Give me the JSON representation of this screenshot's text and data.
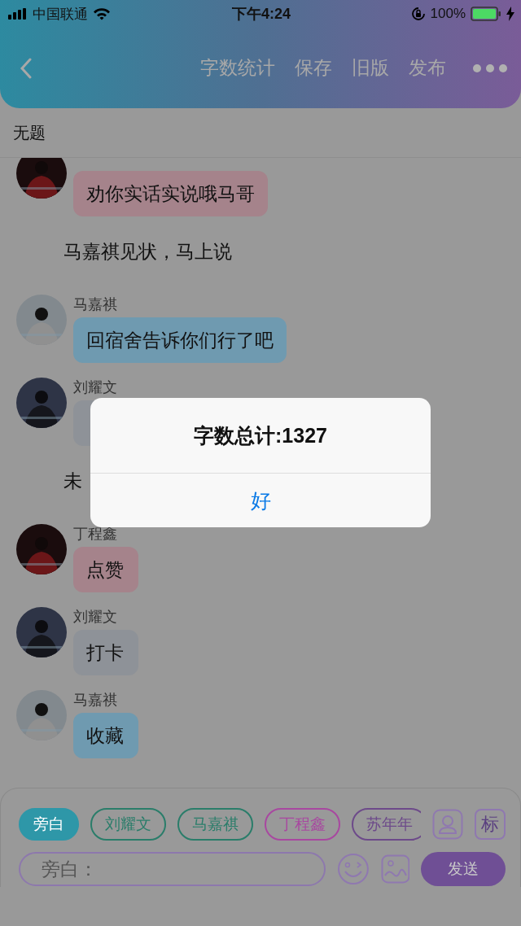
{
  "status_bar": {
    "carrier": "中国联通",
    "time": "下午4:24",
    "battery": "100%"
  },
  "header": {
    "actions": [
      {
        "label": "字数统计"
      },
      {
        "label": "保存"
      },
      {
        "label": "旧版"
      },
      {
        "label": "发布"
      }
    ]
  },
  "title": "无题",
  "messages": [
    {
      "kind": "bubble",
      "color": "#a5838b",
      "text": "劝你实话实说哦马哥"
    },
    {
      "kind": "narration",
      "text": "马嘉祺见状，马上说"
    },
    {
      "kind": "bubble",
      "color": "#6f9ab0",
      "name": "马嘉祺",
      "text": "回宿舍告诉你们行了吧"
    },
    {
      "kind": "bubble",
      "color": "#8e9298",
      "name": "刘耀文"
    },
    {
      "kind": "narration",
      "text": "未"
    },
    {
      "kind": "bubble",
      "color": "#a5838b",
      "name": "丁程鑫",
      "text": "点赞"
    },
    {
      "kind": "bubble",
      "color": "#8e9298",
      "name": "刘耀文",
      "text": "打卡"
    },
    {
      "kind": "bubble",
      "color": "#6f9ab0",
      "name": "马嘉祺",
      "text": "收藏"
    }
  ],
  "composer": {
    "roles": [
      {
        "label": "旁白",
        "selected": true,
        "color": "#2e97a8"
      },
      {
        "label": "刘耀文",
        "selected": false,
        "color": "#2a7d6a"
      },
      {
        "label": "马嘉祺",
        "selected": false,
        "color": "#2a7d6a"
      },
      {
        "label": "丁程鑫",
        "selected": false,
        "color": "#a848a0"
      },
      {
        "label": "苏年年",
        "selected": false,
        "color": "#6d4a8a"
      }
    ],
    "tag_button": "标",
    "placeholder": "旁白：",
    "send": "发送"
  },
  "dialog": {
    "message": "字数总计:1327",
    "button": "好"
  }
}
